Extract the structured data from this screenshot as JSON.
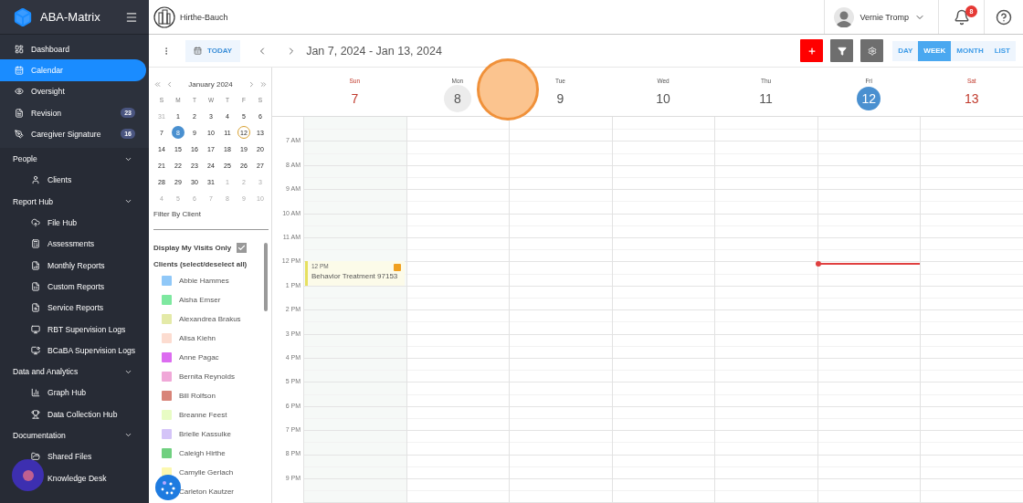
{
  "sidebar": {
    "brand": "ABA-Matrix",
    "items": [
      {
        "label": "Dashboard",
        "selected": false
      },
      {
        "label": "Calendar",
        "selected": true
      },
      {
        "label": "Oversight",
        "selected": false
      },
      {
        "label": "Revision",
        "selected": false,
        "badge": "23"
      },
      {
        "label": "Caregiver Signature",
        "selected": false,
        "badge": "16"
      }
    ],
    "groups": [
      {
        "label": "People",
        "expanded": true,
        "children": [
          {
            "label": "Clients",
            "selected": false
          }
        ]
      },
      {
        "label": "Report Hub",
        "expanded": true,
        "children": [
          {
            "label": "File Hub",
            "selected": false
          },
          {
            "label": "Assessments",
            "selected": false
          },
          {
            "label": "Monthly Reports",
            "selected": false
          },
          {
            "label": "Custom Reports",
            "selected": false
          },
          {
            "label": "Service Reports",
            "selected": false
          },
          {
            "label": "RBT Supervision Logs",
            "selected": false
          },
          {
            "label": "BCaBA Supervision Logs",
            "selected": false
          }
        ]
      },
      {
        "label": "Data and Analytics",
        "expanded": true,
        "children": [
          {
            "label": "Graph Hub",
            "selected": false
          },
          {
            "label": "Data Collection Hub",
            "selected": false
          }
        ]
      },
      {
        "label": "Documentation",
        "expanded": true,
        "children": [
          {
            "label": "Shared Files",
            "selected": false
          },
          {
            "label": "Knowledge Desk",
            "selected": false
          }
        ]
      }
    ]
  },
  "topbar": {
    "organization": "Hirthe-Bauch",
    "user": "Vernie Tromp",
    "notifications": "8"
  },
  "toolbar": {
    "today": "TODAY",
    "range": "Jan 7, 2024 - Jan 13, 2024",
    "views": [
      {
        "label": "DAY",
        "selected": false
      },
      {
        "label": "WEEK",
        "selected": true
      },
      {
        "label": "MONTH",
        "selected": false
      },
      {
        "label": "LIST",
        "selected": false
      }
    ]
  },
  "mini_calendar": {
    "title": "January 2024",
    "weekdays": [
      "S",
      "M",
      "T",
      "W",
      "T",
      "F",
      "S"
    ],
    "weeks": [
      [
        {
          "d": "31",
          "muted": true,
          "selected": false,
          "today": false
        },
        {
          "d": "1",
          "muted": false,
          "selected": false,
          "today": false
        },
        {
          "d": "2",
          "muted": false,
          "selected": false,
          "today": false
        },
        {
          "d": "3",
          "muted": false,
          "selected": false,
          "today": false
        },
        {
          "d": "4",
          "muted": false,
          "selected": false,
          "today": false
        },
        {
          "d": "5",
          "muted": false,
          "selected": false,
          "today": false
        },
        {
          "d": "6",
          "muted": false,
          "selected": false,
          "today": false
        }
      ],
      [
        {
          "d": "7",
          "muted": false,
          "selected": false,
          "today": false
        },
        {
          "d": "8",
          "muted": false,
          "selected": true,
          "today": false
        },
        {
          "d": "9",
          "muted": false,
          "selected": false,
          "today": false
        },
        {
          "d": "10",
          "muted": false,
          "selected": false,
          "today": false
        },
        {
          "d": "11",
          "muted": false,
          "selected": false,
          "today": false
        },
        {
          "d": "12",
          "muted": false,
          "selected": false,
          "today": true
        },
        {
          "d": "13",
          "muted": false,
          "selected": false,
          "today": false
        }
      ],
      [
        {
          "d": "14",
          "muted": false,
          "selected": false,
          "today": false
        },
        {
          "d": "15",
          "muted": false,
          "selected": false,
          "today": false
        },
        {
          "d": "16",
          "muted": false,
          "selected": false,
          "today": false
        },
        {
          "d": "17",
          "muted": false,
          "selected": false,
          "today": false
        },
        {
          "d": "18",
          "muted": false,
          "selected": false,
          "today": false
        },
        {
          "d": "19",
          "muted": false,
          "selected": false,
          "today": false
        },
        {
          "d": "20",
          "muted": false,
          "selected": false,
          "today": false
        }
      ],
      [
        {
          "d": "21",
          "muted": false,
          "selected": false,
          "today": false
        },
        {
          "d": "22",
          "muted": false,
          "selected": false,
          "today": false
        },
        {
          "d": "23",
          "muted": false,
          "selected": false,
          "today": false
        },
        {
          "d": "24",
          "muted": false,
          "selected": false,
          "today": false
        },
        {
          "d": "25",
          "muted": false,
          "selected": false,
          "today": false
        },
        {
          "d": "26",
          "muted": false,
          "selected": false,
          "today": false
        },
        {
          "d": "27",
          "muted": false,
          "selected": false,
          "today": false
        }
      ],
      [
        {
          "d": "28",
          "muted": false,
          "selected": false,
          "today": false
        },
        {
          "d": "29",
          "muted": false,
          "selected": false,
          "today": false
        },
        {
          "d": "30",
          "muted": false,
          "selected": false,
          "today": false
        },
        {
          "d": "31",
          "muted": false,
          "selected": false,
          "today": false
        },
        {
          "d": "1",
          "muted": true,
          "selected": false,
          "today": false
        },
        {
          "d": "2",
          "muted": true,
          "selected": false,
          "today": false
        },
        {
          "d": "3",
          "muted": true,
          "selected": false,
          "today": false
        }
      ],
      [
        {
          "d": "4",
          "muted": true,
          "selected": false,
          "today": false
        },
        {
          "d": "5",
          "muted": true,
          "selected": false,
          "today": false
        },
        {
          "d": "6",
          "muted": true,
          "selected": false,
          "today": false
        },
        {
          "d": "7",
          "muted": true,
          "selected": false,
          "today": false
        },
        {
          "d": "8",
          "muted": true,
          "selected": false,
          "today": false
        },
        {
          "d": "9",
          "muted": true,
          "selected": false,
          "today": false
        },
        {
          "d": "10",
          "muted": true,
          "selected": false,
          "today": false
        }
      ]
    ]
  },
  "filter": {
    "label": "Filter By Client",
    "my_visits_label": "Display My Visits Only",
    "my_visits_checked": true,
    "clients_heading": "Clients (select/deselect all)",
    "clients": [
      {
        "name": "Abbie Hammes",
        "color": "#90c8f8"
      },
      {
        "name": "Aisha Emser",
        "color": "#7ee8a0"
      },
      {
        "name": "Alexandrea Brakus",
        "color": "#e4eaa8"
      },
      {
        "name": "Alisa Kiehn",
        "color": "#fcdcd0"
      },
      {
        "name": "Anne Pagac",
        "color": "#dc6cf0"
      },
      {
        "name": "Bernita Reynolds",
        "color": "#f0a8d8"
      },
      {
        "name": "Bill Rolfson",
        "color": "#d88478"
      },
      {
        "name": "Breanne Feest",
        "color": "#e8fcc4"
      },
      {
        "name": "Brielle Kassulke",
        "color": "#d4c4f8"
      },
      {
        "name": "Caleigh Hirthe",
        "color": "#70d080"
      },
      {
        "name": "Camylle Gerlach",
        "color": "#fcf8b0"
      },
      {
        "name": "Carleton Kautzer"
      }
    ]
  },
  "week": {
    "days": [
      {
        "name": "Sun",
        "date": "7",
        "weekend": true,
        "selected": false,
        "today": false,
        "events": [
          {
            "time": "12 PM",
            "title": "Behavior Treatment 97153"
          }
        ]
      },
      {
        "name": "Mon",
        "date": "8",
        "weekend": false,
        "selected": true,
        "today": false
      },
      {
        "name": "Tue",
        "date": "9",
        "weekend": false,
        "selected": false,
        "today": false
      },
      {
        "name": "Wed",
        "date": "10",
        "weekend": false,
        "selected": false,
        "today": false
      },
      {
        "name": "Thu",
        "date": "11",
        "weekend": false,
        "selected": false,
        "today": false
      },
      {
        "name": "Fri",
        "date": "12",
        "weekend": false,
        "selected": false,
        "today": true
      },
      {
        "name": "Sat",
        "date": "13",
        "weekend": true,
        "selected": false,
        "today": false
      }
    ],
    "hours": [
      "7 AM",
      "8 AM",
      "9 AM",
      "10 AM",
      "11 AM",
      "12 PM",
      "1 PM",
      "2 PM",
      "3 PM",
      "4 PM",
      "5 PM",
      "6 PM",
      "7 PM",
      "8 PM",
      "9 PM"
    ]
  }
}
